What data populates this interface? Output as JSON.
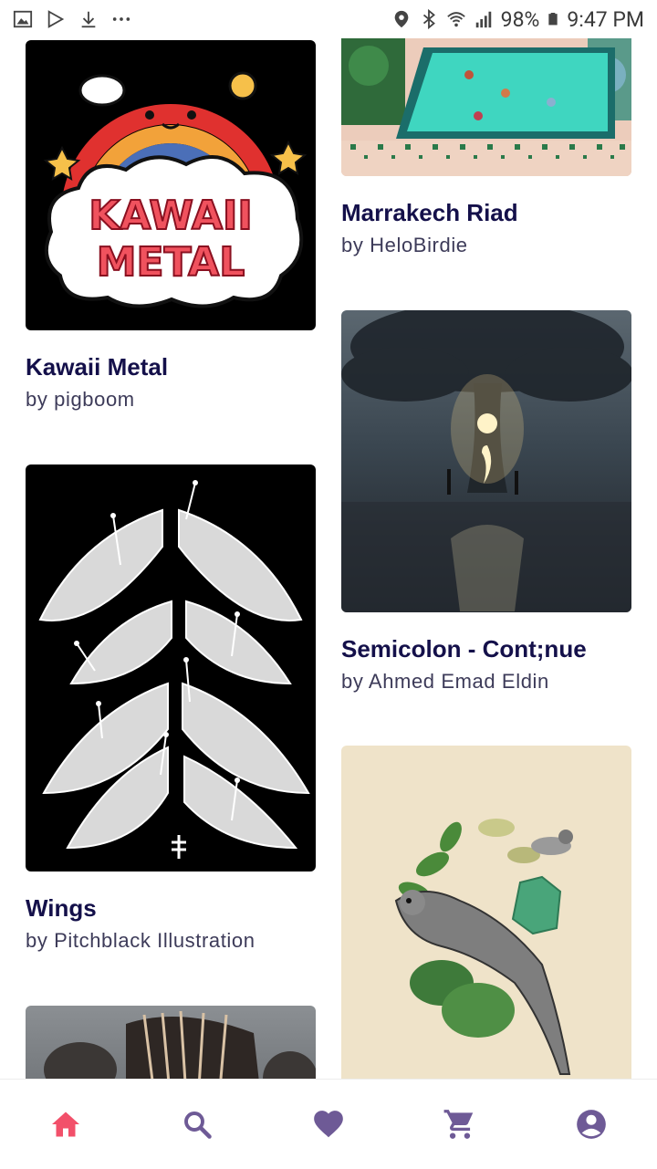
{
  "status_bar": {
    "battery": "98%",
    "time": "9:47 PM"
  },
  "feed": {
    "items": [
      {
        "title": "Kawaii Metal",
        "artist": "by pigboom",
        "art_text_line1": "KAWAII",
        "art_text_line2": "METAL"
      },
      {
        "title": "Marrakech Riad",
        "artist": "by HeloBirdie"
      },
      {
        "title": "Wings",
        "artist": "by Pitchblack Illustration"
      },
      {
        "title": "Semicolon - Cont;nue",
        "artist": "by Ahmed Emad Eldin"
      },
      {
        "title": "",
        "artist": ""
      },
      {
        "title": "",
        "artist": ""
      }
    ]
  },
  "bottom_nav": {
    "items": [
      {
        "icon": "home-icon",
        "active": true
      },
      {
        "icon": "search-icon",
        "active": false
      },
      {
        "icon": "heart-icon",
        "active": false
      },
      {
        "icon": "cart-icon",
        "active": false
      },
      {
        "icon": "account-icon",
        "active": false
      }
    ],
    "active_color": "#f2506a",
    "inactive_color": "#6e5a96"
  }
}
